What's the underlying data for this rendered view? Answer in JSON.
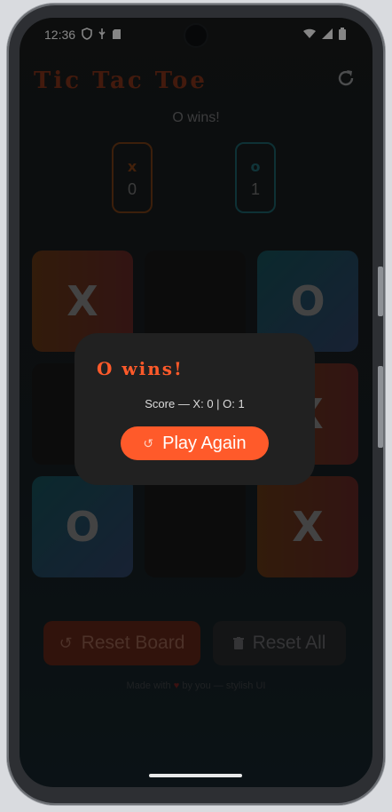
{
  "status_bar": {
    "time": "12:36"
  },
  "header": {
    "title": "Tic Tac Toe"
  },
  "game_status": "O wins!",
  "scores": {
    "x": {
      "symbol": "x",
      "value": "0"
    },
    "o": {
      "symbol": "o",
      "value": "1"
    }
  },
  "board": {
    "cells": [
      "X",
      "",
      "O",
      "",
      "",
      "X",
      "O",
      "",
      "X"
    ]
  },
  "modal": {
    "title": "O wins!",
    "score_text": "Score — X: 0  |  O: 1",
    "play_again_label": "Play Again"
  },
  "buttons": {
    "reset_board_label": "Reset Board",
    "reset_all_label": "Reset All"
  },
  "footer": {
    "before": "Made with",
    "after": "by you — stylish UI"
  },
  "colors": {
    "accent": "#ff5a2a",
    "x_gradient": [
      "#5b3314",
      "#5b2523"
    ],
    "o_gradient": [
      "#144a52",
      "#2c3d5e"
    ]
  },
  "icons": [
    "shield-icon",
    "usb-icon",
    "sd-card-icon",
    "wifi-icon",
    "signal-icon",
    "battery-icon",
    "refresh-icon",
    "undo-icon",
    "trash-icon",
    "heart-icon"
  ]
}
